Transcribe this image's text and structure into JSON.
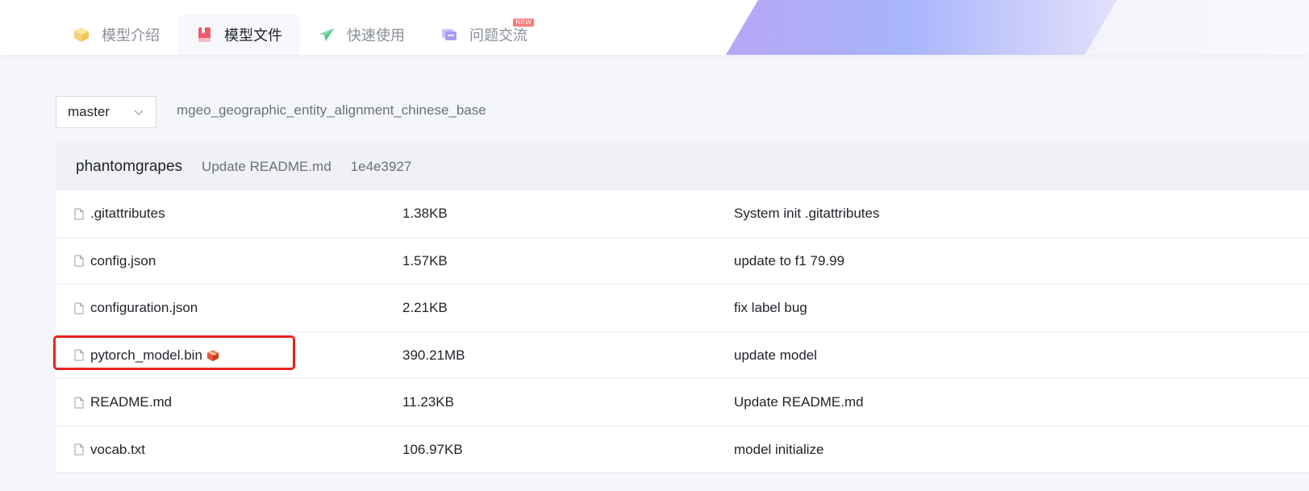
{
  "tabs": [
    {
      "label": "模型介绍",
      "icon": "cube-icon",
      "active": false
    },
    {
      "label": "模型文件",
      "icon": "book-icon",
      "active": true
    },
    {
      "label": "快速使用",
      "icon": "paper-plane-icon",
      "active": false
    },
    {
      "label": "问题交流",
      "icon": "chat-icon",
      "active": false,
      "badge": "NEW"
    }
  ],
  "branch": {
    "selected": "master"
  },
  "repo": {
    "path": "mgeo_geographic_entity_alignment_chinese_base"
  },
  "commit": {
    "author": "phantomgrapes",
    "message": "Update README.md",
    "hash": "1e4e3927"
  },
  "files": [
    {
      "name": ".gitattributes",
      "size": "1.38KB",
      "message": "System init .gitattributes",
      "lfs": false
    },
    {
      "name": "config.json",
      "size": "1.57KB",
      "message": "update to f1 79.99",
      "lfs": false
    },
    {
      "name": "configuration.json",
      "size": "2.21KB",
      "message": "fix label bug",
      "lfs": false
    },
    {
      "name": "pytorch_model.bin",
      "size": "390.21MB",
      "message": "update model",
      "lfs": true
    },
    {
      "name": "README.md",
      "size": "11.23KB",
      "message": "Update README.md",
      "lfs": false
    },
    {
      "name": "vocab.txt",
      "size": "106.97KB",
      "message": "model initialize",
      "lfs": false
    }
  ],
  "colors": {
    "highlight": "#e8221b",
    "badge": "#ff7a7a",
    "background": "#f4f6fb"
  }
}
